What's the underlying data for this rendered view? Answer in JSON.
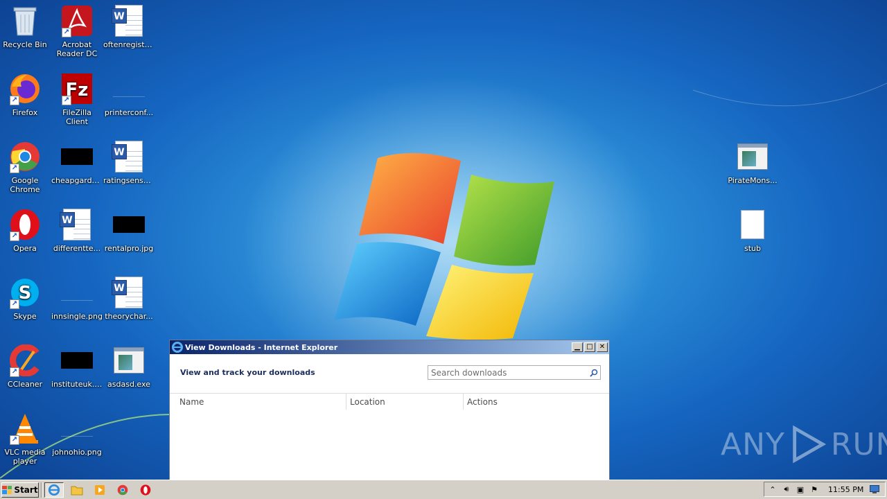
{
  "desktop": {
    "icons": [
      {
        "label": "Recycle Bin",
        "icon": "recycle-bin-icon"
      },
      {
        "label": "Acrobat Reader DC",
        "icon": "acrobat-reader-icon"
      },
      {
        "label": "oftenregiste...",
        "icon": "word-document-icon"
      },
      {
        "label": "Firefox",
        "icon": "firefox-icon"
      },
      {
        "label": "FileZilla Client",
        "icon": "filezilla-icon"
      },
      {
        "label": "printerconf...",
        "icon": "image-file-icon"
      },
      {
        "label": "Google Chrome",
        "icon": "chrome-icon"
      },
      {
        "label": "cheapgarde...",
        "icon": "image-file-icon"
      },
      {
        "label": "ratingsense...",
        "icon": "word-document-icon"
      },
      {
        "label": "Opera",
        "icon": "opera-icon"
      },
      {
        "label": "differentte...",
        "icon": "word-document-icon"
      },
      {
        "label": "rentalpro.jpg",
        "icon": "image-file-icon"
      },
      {
        "label": "Skype",
        "icon": "skype-icon"
      },
      {
        "label": "innsingle.png",
        "icon": "image-file-icon"
      },
      {
        "label": "theorychar...",
        "icon": "word-document-icon"
      },
      {
        "label": "CCleaner",
        "icon": "ccleaner-icon"
      },
      {
        "label": "instituteuk.jpg",
        "icon": "image-file-icon"
      },
      {
        "label": "asdasd.exe",
        "icon": "exe-file-icon"
      },
      {
        "label": "VLC media player",
        "icon": "vlc-icon"
      },
      {
        "label": "johnohio.png",
        "icon": "image-file-icon"
      },
      {
        "label": "PirateMons...",
        "icon": "exe-file-icon"
      },
      {
        "label": "stub",
        "icon": "blank-file-icon"
      }
    ]
  },
  "window": {
    "title": "View Downloads - Internet Explorer",
    "heading": "View and track your downloads",
    "search_placeholder": "Search downloads",
    "columns": [
      "Name",
      "Location",
      "Actions"
    ],
    "buttons": {
      "minimize": "minimize-icon",
      "maximize": "maximize-icon",
      "close": "close-icon"
    }
  },
  "taskbar": {
    "start_label": "Start",
    "pinned": [
      "internet-explorer-icon",
      "folder-icon",
      "media-player-icon",
      "chrome-icon",
      "opera-icon"
    ],
    "clock": "11:55 PM"
  },
  "watermark": {
    "text_left": "ANY",
    "text_right": "RUN"
  },
  "colors": {
    "titlebar_start": "#0a246a",
    "titlebar_end": "#a6caf0",
    "taskbar": "#d4d0c8"
  }
}
